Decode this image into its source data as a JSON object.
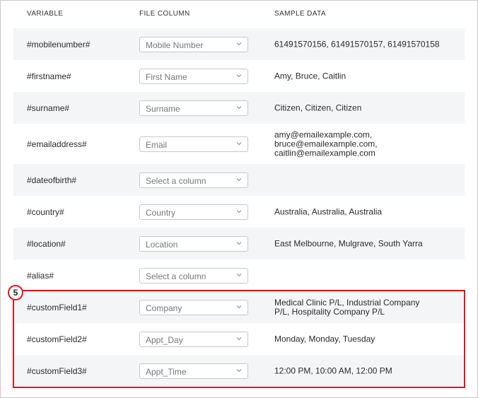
{
  "header": {
    "variable": "VARIABLE",
    "file_column": "FILE COLUMN",
    "sample_data": "SAMPLE DATA"
  },
  "rows": [
    {
      "variable": "#mobilenumber#",
      "column": "Mobile Number",
      "sample": "61491570156, 61491570157, 61491570158"
    },
    {
      "variable": "#firstname#",
      "column": "First Name",
      "sample": "Amy, Bruce, Caitlin"
    },
    {
      "variable": "#surname#",
      "column": "Surname",
      "sample": "Citizen, Citizen, Citizen"
    },
    {
      "variable": "#emailaddress#",
      "column": "Email",
      "sample": "amy@emailexample.com, bruce@emailexample.com, caitlin@emailexample.com"
    },
    {
      "variable": "#dateofbirth#",
      "column": "Select a column",
      "sample": ""
    },
    {
      "variable": "#country#",
      "column": "Country",
      "sample": "Australia, Australia, Australia"
    },
    {
      "variable": "#location#",
      "column": "Location",
      "sample": "East Melbourne, Mulgrave, South Yarra"
    },
    {
      "variable": "#alias#",
      "column": "Select a column",
      "sample": ""
    },
    {
      "variable": "#customField1#",
      "column": "Company",
      "sample": "Medical Clinic P/L, Industrial Company P/L, Hospitality Company P/L"
    },
    {
      "variable": "#customField2#",
      "column": "Appt_Day",
      "sample": "Monday, Monday, Tuesday"
    },
    {
      "variable": "#customField3#",
      "column": "Appt_Time",
      "sample": "12:00 PM, 10:00 AM, 12:00 PM"
    }
  ],
  "callout": {
    "number": "5"
  },
  "colors": {
    "highlight": "#e0161b",
    "row_shade": "#f4f5f7"
  },
  "icons": {
    "dropdown": "chevron-down-icon"
  }
}
